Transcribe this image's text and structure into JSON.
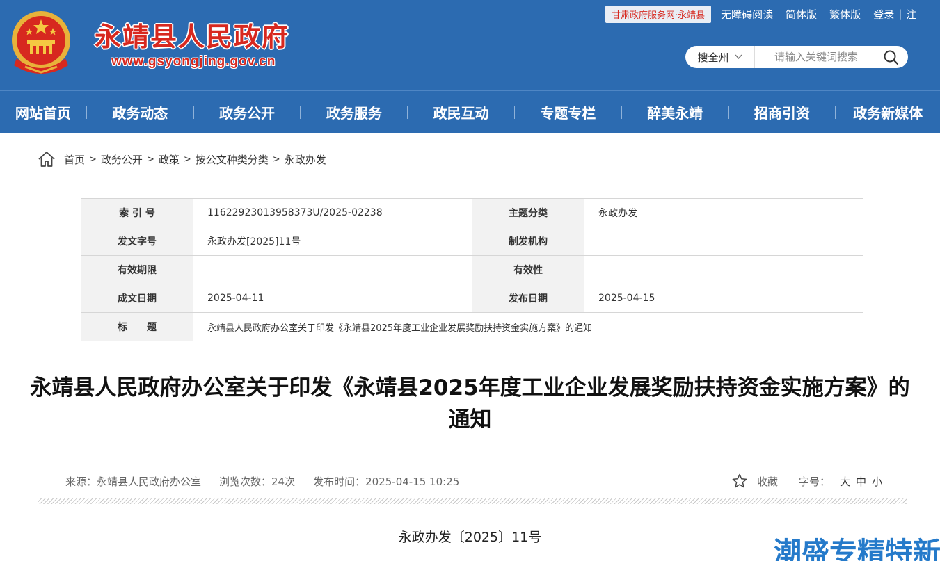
{
  "header": {
    "site_name": "永靖县人民政府",
    "site_url": "www.gsyongjing.gov.cn",
    "portal_tag": "甘肃政府服务网·永靖县",
    "top_links": [
      "无障碍阅读",
      "简体版",
      "繁体版",
      "登录",
      "注"
    ],
    "search_scope": "搜全州",
    "search_placeholder": "请输入关键词搜索"
  },
  "nav": {
    "items": [
      "网站首页",
      "政务动态",
      "政务公开",
      "政务服务",
      "政民互动",
      "专题专栏",
      "醉美永靖",
      "招商引资",
      "政务新媒体"
    ]
  },
  "breadcrumb": [
    "首页",
    "政务公开",
    "政策",
    "按公文种类分类",
    "永政办发"
  ],
  "info_table": {
    "index_label": "索 引 号",
    "index_value": "11622923013958373U/2025-02238",
    "topic_label": "主题分类",
    "topic_value": "永政办发",
    "docno_label": "发文字号",
    "docno_value": "永政办发[2025]11号",
    "issuer_label": "制发机构",
    "issuer_value": "",
    "period_label": "有效期限",
    "period_value": "",
    "validity_label": "有效性",
    "validity_value": "",
    "created_label": "成文日期",
    "created_value": "2025-04-11",
    "published_label": "发布日期",
    "published_value": "2025-04-15",
    "title_label": "标　　题",
    "title_value": "永靖县人民政府办公室关于印发《永靖县2025年度工业企业发展奖励扶持资金实施方案》的通知"
  },
  "article": {
    "title": "永靖县人民政府办公室关于印发《永靖县2025年度工业企业发展奖励扶持资金实施方案》的通知",
    "source": "来源：永靖县人民政府办公室",
    "views": "浏览次数：24次",
    "publish_time": "发布时间：2025-04-15 10:25",
    "favorite": "收藏",
    "font_size_label": "字号：",
    "font_sizes": [
      "大",
      "中",
      "小"
    ],
    "doc_number": "永政办发〔2025〕11号"
  },
  "watermark": "潮盛专精特新",
  "colors": {
    "header_blue": "#2c6bb1",
    "site_name_red": "#d7281f"
  }
}
